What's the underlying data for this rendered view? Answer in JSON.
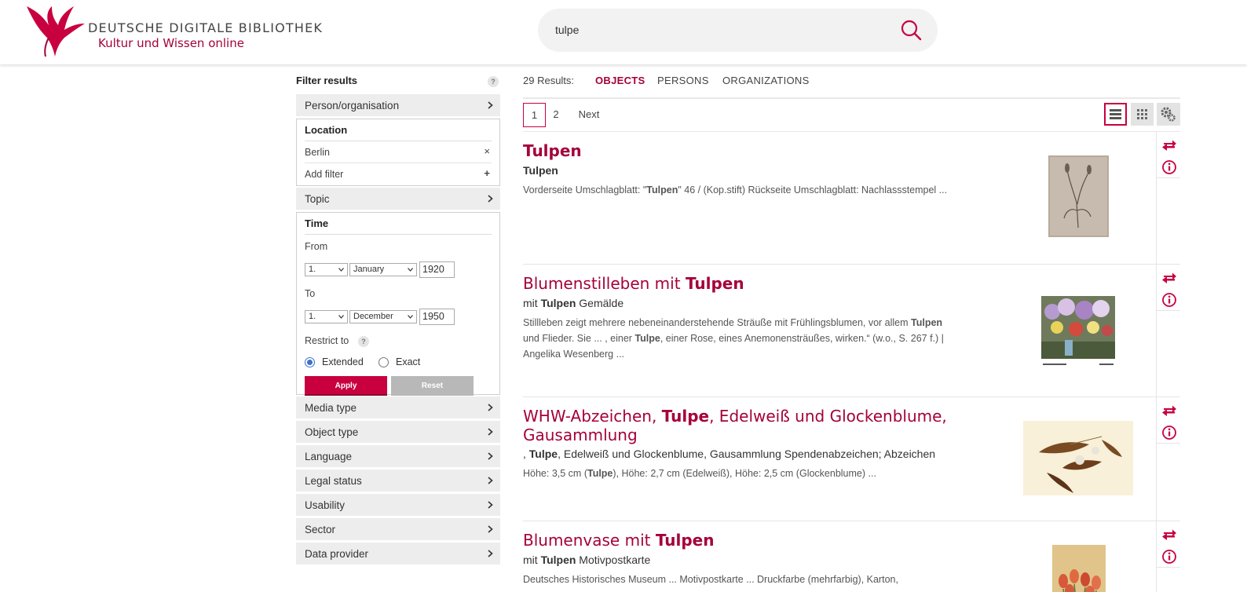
{
  "header": {
    "logo_title": "DEUTSCHE DIGITALE BIBLIOTHEK",
    "logo_subtitle": "Kultur und Wissen online",
    "search_value": "tulpe",
    "icons": {
      "search": "search-icon"
    }
  },
  "colors": {
    "accent": "#a5003b",
    "apply": "#c8003f",
    "radio": "#3a72c8"
  },
  "sidebar": {
    "title": "Filter results",
    "help": "?",
    "facet_person": "Person/organisation",
    "location": {
      "title": "Location",
      "value": "Berlin",
      "remove": "×",
      "add": "Add filter",
      "add_symbol": "+"
    },
    "facet_topic": "Topic",
    "time": {
      "title": "Time",
      "from_label": "From",
      "from_day": "1.",
      "from_month": "January",
      "from_year": "1920",
      "to_label": "To",
      "to_day": "1.",
      "to_month": "December",
      "to_year": "1950",
      "restrict_label": "Restrict to",
      "option_extended": "Extended",
      "option_exact": "Exact",
      "apply": "Apply",
      "reset": "Reset"
    },
    "facets_bottom": [
      "Media type",
      "Object type",
      "Language",
      "Legal status",
      "Usability",
      "Sector",
      "Data provider"
    ]
  },
  "results": {
    "count_label": "29 Results:",
    "tabs": [
      "OBJECTS",
      "PERSONS",
      "ORGANIZATIONS"
    ],
    "pages": [
      "1",
      "2"
    ],
    "next": "Next",
    "items": [
      {
        "title": [
          {
            "t": "Tulpen",
            "b": true
          }
        ],
        "subtitle": [
          {
            "t": "Tulpen",
            "b": true
          }
        ],
        "desc": [
          {
            "t": "Vorderseite Umschlagblatt: \"",
            "b": false
          },
          {
            "t": "Tulpen",
            "b": true
          },
          {
            "t": "\" 46 / (Kop.stift) Rückseite Umschlagblatt: Nachlassstempel ...",
            "b": false
          }
        ]
      },
      {
        "title": [
          {
            "t": "Blumenstilleben mit ",
            "b": false
          },
          {
            "t": "Tulpen",
            "b": true
          }
        ],
        "subtitle": [
          {
            "t": "mit ",
            "b": false
          },
          {
            "t": "Tulpen",
            "b": true
          },
          {
            "t": " Gemälde",
            "b": false
          }
        ],
        "desc": [
          {
            "t": "Stillleben zeigt mehrere nebeneinanderstehende Sträuße mit Frühlingsblumen, vor allem ",
            "b": false
          },
          {
            "t": "Tulpen",
            "b": true
          },
          {
            "t": " und Flieder. Sie ... , einer ",
            "b": false
          },
          {
            "t": "Tulpe",
            "b": true
          },
          {
            "t": ", einer Rose, eines Anemonensträußes, wirken.“ (w.o., S. 267 f.) | Angelika Wesenberg ...",
            "b": false
          }
        ]
      },
      {
        "title": [
          {
            "t": "WHW-Abzeichen, ",
            "b": false
          },
          {
            "t": "Tulpe",
            "b": true
          },
          {
            "t": ", Edelweiß und Glockenblume, Gausammlung",
            "b": false
          }
        ],
        "subtitle": [
          {
            "t": ", ",
            "b": false
          },
          {
            "t": "Tulpe",
            "b": true
          },
          {
            "t": ", Edelweiß und Glockenblume, Gausammlung Spendenabzeichen; Abzeichen",
            "b": false
          }
        ],
        "desc": [
          {
            "t": "Höhe: 3,5 cm (",
            "b": false
          },
          {
            "t": "Tulpe",
            "b": true
          },
          {
            "t": "), Höhe: 2,7 cm (Edelweiß), Höhe: 2,5 cm (Glockenblume) ...",
            "b": false
          }
        ]
      },
      {
        "title": [
          {
            "t": "Blumenvase mit ",
            "b": false
          },
          {
            "t": "Tulpen",
            "b": true
          }
        ],
        "subtitle": [
          {
            "t": "mit ",
            "b": false
          },
          {
            "t": "Tulpen",
            "b": true
          },
          {
            "t": " Motivpostkarte",
            "b": false
          }
        ],
        "desc": [
          {
            "t": "Deutsches Historisches Museum ... Motivpostkarte ... Druckfarbe (mehrfarbig), Karton,",
            "b": false
          }
        ]
      }
    ]
  }
}
